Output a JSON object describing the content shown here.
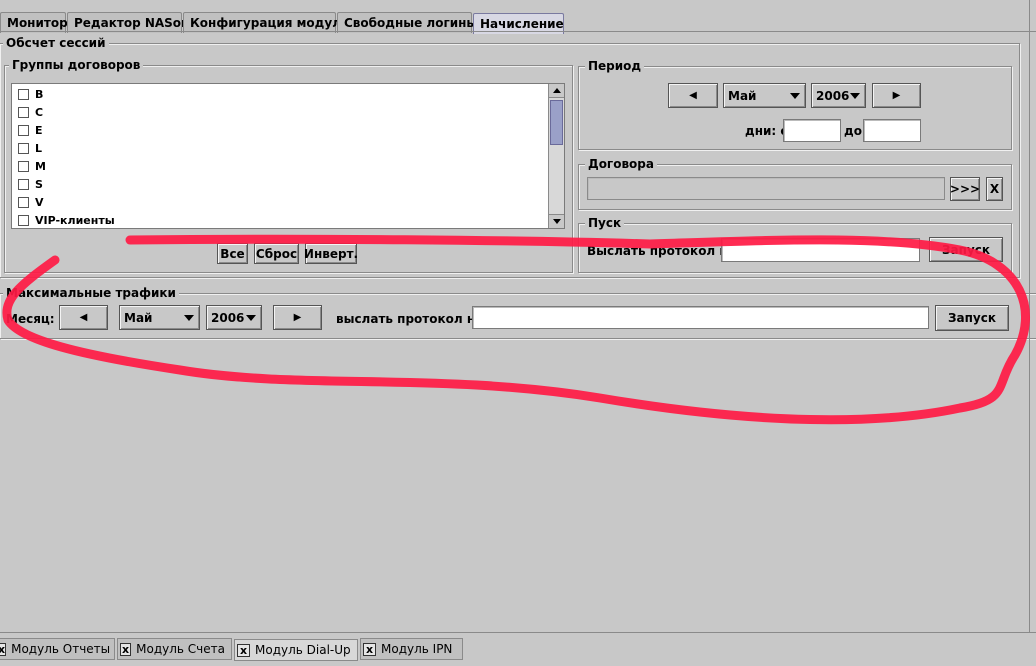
{
  "top_tabs": [
    {
      "label": "Монитор"
    },
    {
      "label": "Редактор NASов"
    },
    {
      "label": "Конфигурация модуля"
    },
    {
      "label": "Свободные логины"
    },
    {
      "label": "Начисление",
      "active": true
    }
  ],
  "sessions": {
    "title": "Обсчет сессий",
    "groups": {
      "title": "Группы договоров",
      "items": [
        "B",
        "C",
        "E",
        "L",
        "M",
        "S",
        "V",
        "VIP-клиенты"
      ],
      "buttons": {
        "all": "Все",
        "reset": "Сброс",
        "invert": "Инверт."
      }
    },
    "period": {
      "title": "Период",
      "month": "Май",
      "year": "2006",
      "days_from_label": "дни: с",
      "days_to_label": "до",
      "days_from": "",
      "days_to": ""
    },
    "contracts": {
      "title": "Договора",
      "value": "",
      "more_label": ">>>",
      "clear_label": "X"
    },
    "start": {
      "title": "Пуск",
      "send_label": "Выслать протокол на:",
      "send_value": "",
      "run_label": "Запуск"
    }
  },
  "max_traffic": {
    "title": "Максимальные трафики",
    "month_label": "Месяц:",
    "month": "Май",
    "year": "2006",
    "send_label": "выслать протокол на:",
    "send_value": "",
    "run_label": "Запуск"
  },
  "bottom_tabs": [
    {
      "label": "Модуль Отчеты"
    },
    {
      "label": "Модуль Счета"
    },
    {
      "label": "Модуль Dial-Up",
      "active": true
    },
    {
      "label": "Модуль IPN"
    }
  ],
  "annotation_color": "#ff1a44"
}
